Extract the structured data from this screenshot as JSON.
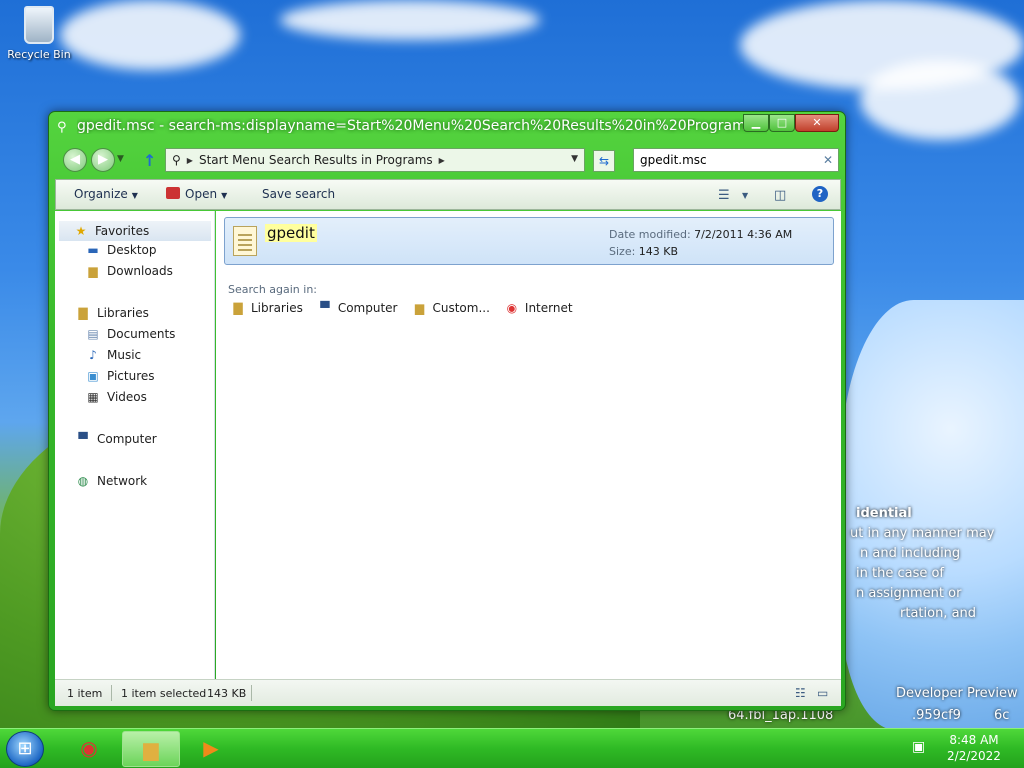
{
  "desktop": {
    "recycle_bin_label": "Recycle Bin",
    "wallpaper_text": [
      "idential",
      "ut in any manner may",
      "n and including",
      "in the case of",
      "n assignment or",
      "rtation, and",
      "Developer Preview",
      "64.fbl_1ap.1108",
      ".959cf9",
      "6c"
    ]
  },
  "window": {
    "title": "gpedit.msc - search-ms:displayname=Start%20Menu%20Search%20Results%20in%20Programs&cru...",
    "address_crumb": "Start Menu Search Results in Programs",
    "search_value": "gpedit.msc",
    "toolbar": {
      "organize": "Organize",
      "open": "Open",
      "save_search": "Save search"
    },
    "nav": {
      "favorites": "Favorites",
      "desktop": "Desktop",
      "downloads": "Downloads",
      "libraries": "Libraries",
      "documents": "Documents",
      "music": "Music",
      "pictures": "Pictures",
      "videos": "Videos",
      "computer": "Computer",
      "network": "Network"
    },
    "result": {
      "name": "gpedit",
      "date_label": "Date modified:",
      "date_value": "7/2/2011 4:36 AM",
      "size_label": "Size:",
      "size_value": "143 KB"
    },
    "search_again": {
      "label": "Search again in:",
      "items": [
        "Libraries",
        "Computer",
        "Custom...",
        "Internet"
      ]
    },
    "status": {
      "count": "1 item",
      "selected": "1 item selected",
      "size": "143 KB"
    }
  },
  "taskbar": {
    "time": "8:48 AM",
    "date": "2/2/2022"
  },
  "colors": {
    "window_accent": "#36b82a",
    "taskbar": "#2fba25",
    "close_button": "#c0402b"
  }
}
